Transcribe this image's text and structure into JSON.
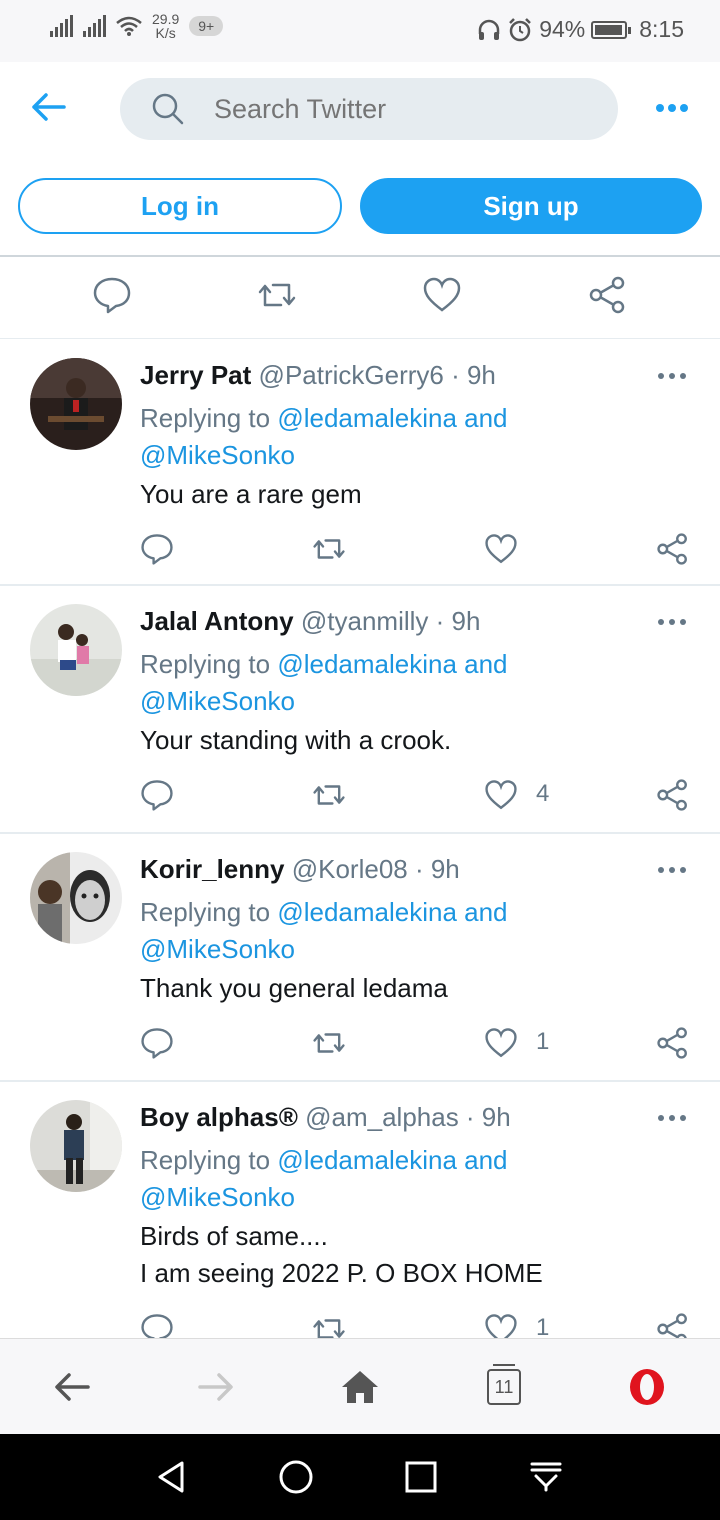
{
  "status_bar": {
    "speed_value": "29.9",
    "speed_unit": "K/s",
    "notif_badge": "9+",
    "battery": "94%",
    "battery_level": 0.94,
    "time": "8:15"
  },
  "header": {
    "search_placeholder": "Search Twitter",
    "login_label": "Log in",
    "signup_label": "Sign up"
  },
  "colors": {
    "accent": "#1da1f2",
    "mention": "#1b95e0",
    "muted": "#657786",
    "opera_red": "#e0141e"
  },
  "replies": [
    {
      "name": "Jerry Pat",
      "meta": "@PatrickGerry6 · 9h",
      "replying_prefix": "Replying to ",
      "mention1": "@ledamalekina and",
      "mention2": "@MikeSonko",
      "text": [
        "You are a rare gem"
      ],
      "likes": ""
    },
    {
      "name": "Jalal Antony",
      "meta": "@tyanmilly · 9h",
      "replying_prefix": "Replying to ",
      "mention1": "@ledamalekina and",
      "mention2": "@MikeSonko",
      "text": [
        "Your standing with a crook."
      ],
      "likes": "4"
    },
    {
      "name": "Korir_lenny",
      "meta": "@Korle08 · 9h",
      "replying_prefix": "Replying to ",
      "mention1": "@ledamalekina and",
      "mention2": "@MikeSonko",
      "text": [
        "Thank you general ledama"
      ],
      "likes": "1"
    },
    {
      "name": "Boy alphas®",
      "meta": "@am_alphas · 9h",
      "replying_prefix": "Replying to ",
      "mention1": "@ledamalekina and",
      "mention2": "@MikeSonko",
      "text": [
        "Birds of same....",
        "I am seeing 2022 P. O BOX HOME"
      ],
      "likes": "1"
    }
  ],
  "browser_nav": {
    "tab_count": "11"
  }
}
